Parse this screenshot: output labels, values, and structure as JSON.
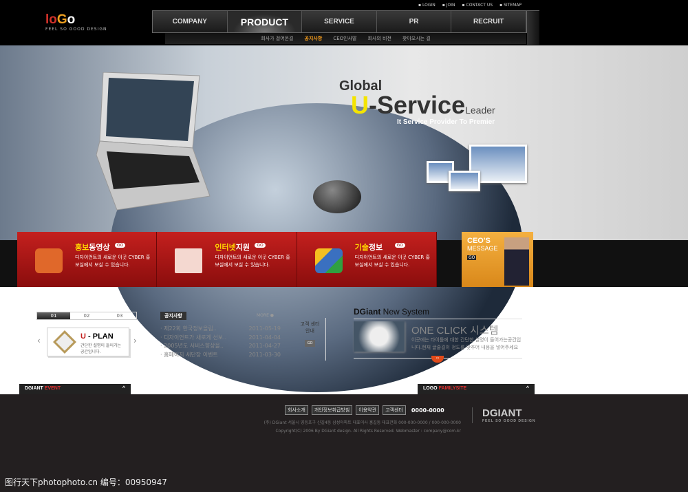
{
  "header": {
    "logo": {
      "a": "lo",
      "b": "G",
      "c": "o"
    },
    "slogan": "FEEL SO GOOD DESIGN",
    "util": [
      "LOGIN",
      "JOIN",
      "CONTACT US",
      "SITEMAP"
    ],
    "nav": [
      "COMPANY",
      "PRODUCT",
      "SERVICE",
      "PR",
      "RECRUIT"
    ],
    "nav_active": "PRODUCT",
    "subnav": [
      "회사가 걸어온길",
      "공지사항",
      "CEO인사말",
      "회사의 비전",
      "찾아오시는 길"
    ],
    "subnav_active": "공지사항"
  },
  "hero": {
    "line1": "Global",
    "u": "U",
    "service": "-Service",
    "leader": "Leader",
    "tagline": "It Service Provider To Premier"
  },
  "features": [
    {
      "hi": "홍보",
      "rest": "동영상",
      "go": "GO",
      "desc": "디자이언트의 새로운 이곳 CYBER 홍보실에서 보실 수 있습니다.",
      "icon": "tv-icon"
    },
    {
      "hi": "인터넷",
      "rest": "지원",
      "go": "GO",
      "desc": "디자이언트의 새로운 이곳 CYBER 홍보실에서 보실 수 있습니다.",
      "icon": "internet-explorer-icon"
    },
    {
      "hi": "기술",
      "rest": "정보",
      "go": "GO",
      "desc": "디자이언트의 새로운 이곳 CYBER 홍보실에서 보실 수 있습니다.",
      "icon": "blocks-icon"
    }
  ],
  "ceo": {
    "line1": "CEO'S",
    "line2": "MESSAGE",
    "go": "GO"
  },
  "slider": {
    "tabs": [
      "01",
      "02",
      "03"
    ],
    "title_u": "U",
    "title_rest": " - PLAN",
    "desc": "간단한 설명이 들어가는 공간입니다."
  },
  "notice": {
    "title": "공지사항",
    "more": "MORE",
    "items": [
      {
        "t": "제22회 한국정보올림..",
        "d": "2011-05-19"
      },
      {
        "t": "디자이언트가 새로게 선보..",
        "d": "2011-04-04"
      },
      {
        "t": "2005년도 서비스향상을..",
        "d": "2011-04-27"
      },
      {
        "t": "홈페이지 새단장 이벤트",
        "d": "2011-03-30"
      }
    ]
  },
  "customer": {
    "label": "고객 센터 안내",
    "go": "GO"
  },
  "system": {
    "brand": "DGiant",
    "title": " New System",
    "headline": "ONE CLICK 시스템",
    "desc": "이곳에는 타이틀에 대한 간단한 설명이 들어가는공간입니다.현재 글줄길이 정도를 맞추어 내용을 넣어주세요"
  },
  "event_tab": {
    "a": "DGIANT",
    "b": "EVENT"
  },
  "family_tab": {
    "a": "LOGO",
    "b": "FAMILYSITE"
  },
  "footer": {
    "links": [
      "회사소개",
      "개인정보취급방침",
      "이용약관",
      "고객센터"
    ],
    "phone": "0000-0000",
    "address": "(주) DGiant 서울시 영등포구 신길4동 삼성아파트   대표이사 홍길동     대표전화 000-000-0000 / 000-000-0000",
    "copyright": "Copyright(C) 2006 By DGiant design. All Rights Reserved. Webmaster : company@com.kr",
    "brand": "DGIANT",
    "brand_slogan": "FEEL SO GOOD DESIGN"
  },
  "watermark": "图行天下photophoto.cn  编号：00950947",
  "colors": {
    "accent_red": "#c4201e",
    "accent_orange": "#f29a1a",
    "yellow": "#f4e400",
    "footer_bg": "#231f20"
  }
}
